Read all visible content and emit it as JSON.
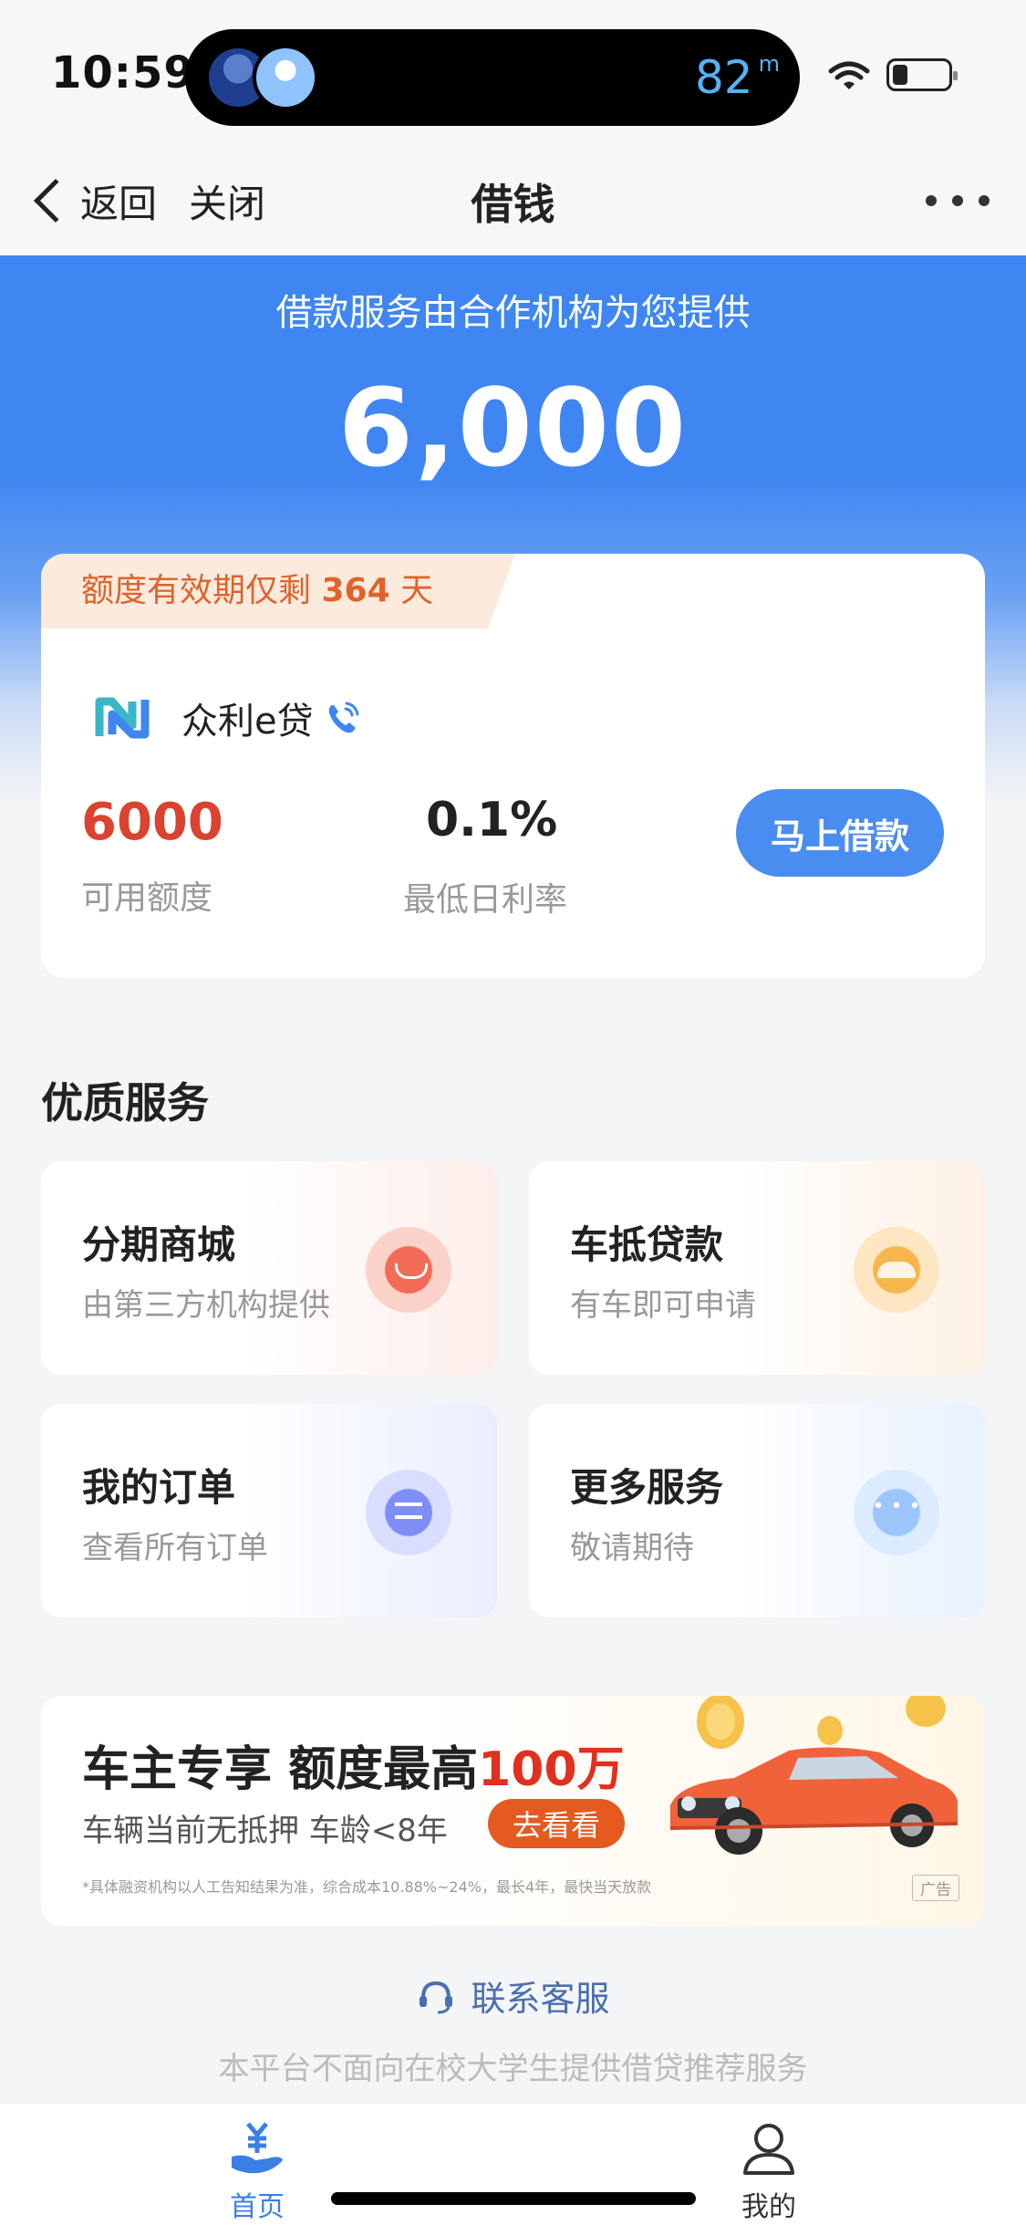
{
  "status_bar": {
    "time": "10:59",
    "distance_value": "82",
    "distance_unit": "m",
    "icons": [
      "wifi-icon",
      "battery-icon"
    ]
  },
  "nav": {
    "back_label": "返回",
    "close_label": "关闭",
    "title": "借钱"
  },
  "hero": {
    "subtitle": "借款服务由合作机构为您提供",
    "amount": "6,000"
  },
  "credit_card": {
    "validity_prefix": "额度有效期仅剩",
    "validity_days": "364",
    "validity_suffix": "天",
    "lender_name": "众利e贷",
    "limit_value": "6000",
    "limit_label": "可用额度",
    "rate_value": "0.1%",
    "rate_label": "最低日利率",
    "borrow_button": "马上借款"
  },
  "services": {
    "title": "优质服务",
    "items": [
      {
        "title": "分期商城",
        "subtitle": "由第三方机构提供",
        "icon": "shopping-bag-icon",
        "color": "#f26b57"
      },
      {
        "title": "车抵贷款",
        "subtitle": "有车即可申请",
        "icon": "car-icon",
        "color": "#f7b64b"
      },
      {
        "title": "我的订单",
        "subtitle": "查看所有订单",
        "icon": "order-icon",
        "color": "#7f8ef5"
      },
      {
        "title": "更多服务",
        "subtitle": "敬请期待",
        "icon": "more-dots-icon",
        "color": "#9cc6fb"
      }
    ]
  },
  "ad": {
    "headline_prefix": "车主专享 额度最高",
    "headline_highlight": "100万",
    "subline": "车辆当前无抵押 车龄<8年",
    "cta": "去看看",
    "disclaimer": "*具体融资机构以人工告知结果为准，综合成本10.88%~24%，最长4年，最快当天放款",
    "ad_label": "广告"
  },
  "footer": {
    "contact_label": "联系客服",
    "note": "本平台不面向在校大学生提供借贷推荐服务"
  },
  "tab_bar": {
    "home_label": "首页",
    "mine_label": "我的"
  },
  "colors": {
    "brand_blue": "#3f86f2",
    "accent_red": "#d9432f",
    "tag_orange": "#e0622c"
  }
}
